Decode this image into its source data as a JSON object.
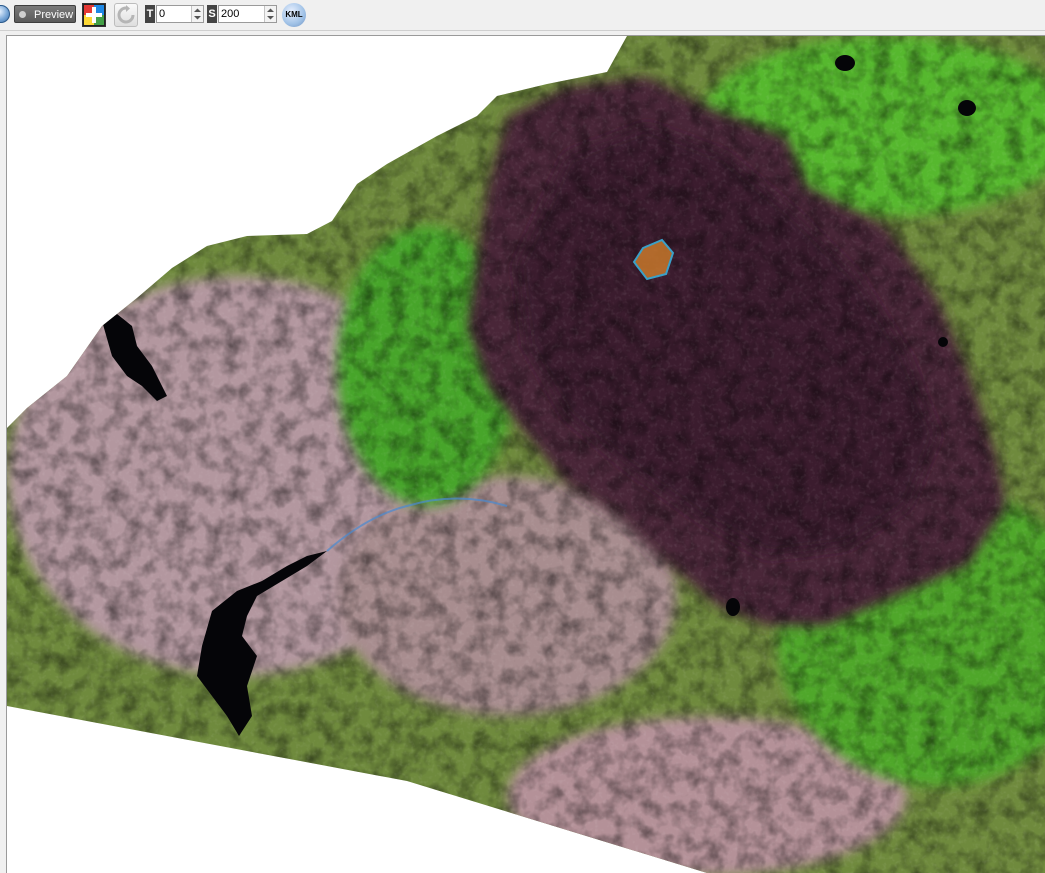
{
  "toolbar": {
    "preview_label": "Preview",
    "t_letter": "T",
    "t_value": "0",
    "s_letter": "S",
    "s_value": "200",
    "kml_label": "KML"
  },
  "colors": {
    "burn_scar": "#4a2638",
    "vegetation": "#3fae2a",
    "bare_soil": "#b99aa6",
    "water": "#050508",
    "aoi_fill": "#c8782c",
    "aoi_stroke": "#3aa0c8"
  },
  "icons": {
    "color_picker": "color-grid-icon",
    "refresh": "refresh-icon",
    "kml": "kml-globe-icon"
  }
}
